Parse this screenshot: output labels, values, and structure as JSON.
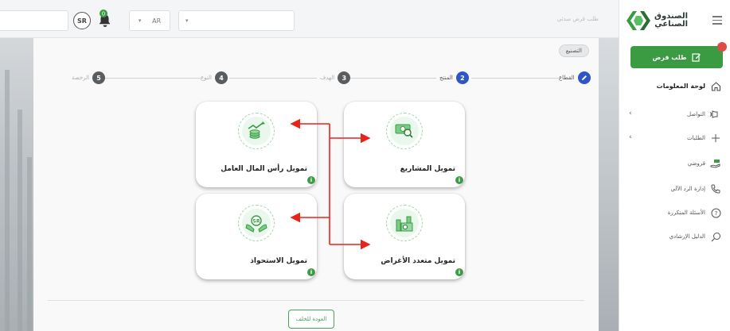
{
  "topbar": {
    "user_name": "",
    "currency_badge": "SR",
    "language": "AR",
    "search_value": "",
    "search_hint": "طلب قرض مبدئي"
  },
  "page": {
    "tag": "التصنيع",
    "steps": [
      {
        "number": "",
        "label": "القطاع",
        "state": "done"
      },
      {
        "number": "2",
        "label": "المنتج",
        "state": "active"
      },
      {
        "number": "3",
        "label": "الهدف",
        "state": "pending"
      },
      {
        "number": "4",
        "label": "النوع",
        "state": "pending"
      },
      {
        "number": "5",
        "label": "الرخصة",
        "state": "pending"
      }
    ],
    "cards": [
      {
        "title": "تمويل المشاريع",
        "icon": "money-search-icon",
        "info": "i"
      },
      {
        "title": "تمويل رأس المال العامل",
        "icon": "coins-growth-icon",
        "info": "i"
      },
      {
        "title": "تمويل متعدد الأغراض",
        "icon": "factory-icon",
        "info": "i"
      },
      {
        "title": "تمويل الاستحواذ",
        "icon": "hands-sr-icon",
        "info": "i"
      }
    ],
    "back_button": "العودة للخلف"
  },
  "sidebar": {
    "logo_line1": "الصندوق",
    "logo_line2": "الصناعي",
    "new_loan": "طلب قرض",
    "items": [
      {
        "label": "لوحة المعلومات",
        "icon": "home-icon"
      },
      {
        "label": "التواصل",
        "icon": "megaphone-icon"
      },
      {
        "label": "الطلبات",
        "icon": "plus-icon"
      },
      {
        "label": "قروضي",
        "icon": "hand-money-icon"
      },
      {
        "label": "إدارة الرد الآلي",
        "icon": "phone-icon"
      },
      {
        "label": "الأسئلة المتكررة",
        "icon": "question-icon"
      },
      {
        "label": "الدليل الإرشادي",
        "icon": "search-icon"
      }
    ]
  },
  "colors": {
    "brand_green": "#3a9b43",
    "step_blue": "#2f56c7",
    "arrow_red": "#e8241a"
  }
}
